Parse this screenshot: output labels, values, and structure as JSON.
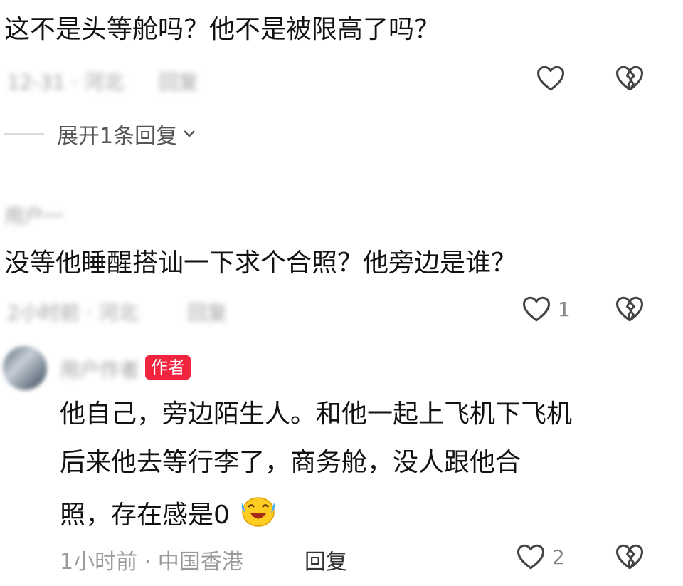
{
  "comments": [
    {
      "text": "这不是头等舱吗？他不是被限高了吗？",
      "meta_blurred": "12-31 · 河北",
      "reply_blurred": "回复",
      "like_count": ""
    },
    {
      "username_blurred": "用户一",
      "text": "没等他睡醒搭讪一下求个合照？他旁边是谁？",
      "meta_blurred": "2小时前 · 河北",
      "reply_blurred": "回复",
      "like_count": "1"
    },
    {
      "username_blurred": "用户作者",
      "badge": "作者",
      "text_line1": "他自己，旁边陌生人。和他一起上飞机下飞机",
      "text_line2": "后来他去等行李了，商务舱，没人跟他合",
      "text_line3": "照，存在感是0",
      "emoji": "laughing-crying-emoji",
      "meta": "1小时前 · 中国香港",
      "reply": "回复",
      "like_count": "2"
    }
  ],
  "expand_replies": "展开1条回复",
  "colors": {
    "badge": "#f0243f",
    "meta": "#9a9a9a",
    "text": "#121212"
  }
}
